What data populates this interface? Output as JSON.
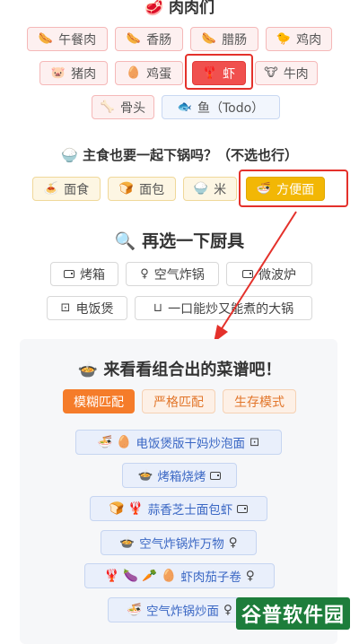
{
  "meat": {
    "title": "🥩 肉肉们",
    "items": [
      {
        "icon": "🌭",
        "label": "午餐肉",
        "selected": false
      },
      {
        "icon": "🌭",
        "label": "香肠",
        "selected": false
      },
      {
        "icon": "🌭",
        "label": "腊肠",
        "selected": false
      },
      {
        "icon": "🐤",
        "label": "鸡肉",
        "selected": false
      },
      {
        "icon": "🐷",
        "label": "猪肉",
        "selected": false
      },
      {
        "icon": "🥚",
        "label": "鸡蛋",
        "selected": false
      },
      {
        "icon": "🦞",
        "label": "虾",
        "selected": true
      },
      {
        "icon": "🐮",
        "label": "牛肉",
        "selected": false
      },
      {
        "icon": "🦴",
        "label": "骨头",
        "selected": false
      },
      {
        "icon": "🐟",
        "label": "鱼（Todo）",
        "selected": false
      }
    ]
  },
  "staple": {
    "title_icon": "🍚",
    "title": "主食也要一起下锅吗？（不选也行）",
    "items": [
      {
        "icon": "🍝",
        "label": "面食",
        "selected": false
      },
      {
        "icon": "🍞",
        "label": "面包",
        "selected": false
      },
      {
        "icon": "🍚",
        "label": "米",
        "selected": false
      },
      {
        "icon": "🍜",
        "label": "方便面",
        "selected": true
      }
    ]
  },
  "tools": {
    "title_icon": "🔍",
    "title": "再选一下厨具",
    "items": [
      {
        "label": "烤箱"
      },
      {
        "label": "空气炸锅"
      },
      {
        "label": "微波炉"
      },
      {
        "label": "电饭煲"
      },
      {
        "label": "一口能炒又能煮的大锅"
      }
    ]
  },
  "results": {
    "title_icon": "🍲",
    "title": "来看看组合出的菜谱吧！",
    "modes": [
      "模糊匹配",
      "严格匹配",
      "生存模式"
    ],
    "active_mode": "模糊匹配",
    "recipes": [
      {
        "icons": "🍜 🥚",
        "label": "电饭煲版干妈炒泡面"
      },
      {
        "icons": "🍲",
        "label": "烤箱烧烤"
      },
      {
        "icons": "🍞 🦞",
        "label": "蒜香芝士面包虾"
      },
      {
        "icons": "🍲",
        "label": "空气炸锅炸万物"
      },
      {
        "icons": "🦞 🍆 🥕 🥚",
        "label": "虾肉茄子卷"
      },
      {
        "icons": "🍜",
        "label": "空气炸锅炒面"
      }
    ]
  },
  "colors": {
    "selected_meat": "#f0504e",
    "selected_staple": "#f2b705",
    "active_mode": "#f57c2a",
    "highlight": "#e4312b",
    "recipe_text": "#3a67c4"
  },
  "watermark": "谷普软件园"
}
